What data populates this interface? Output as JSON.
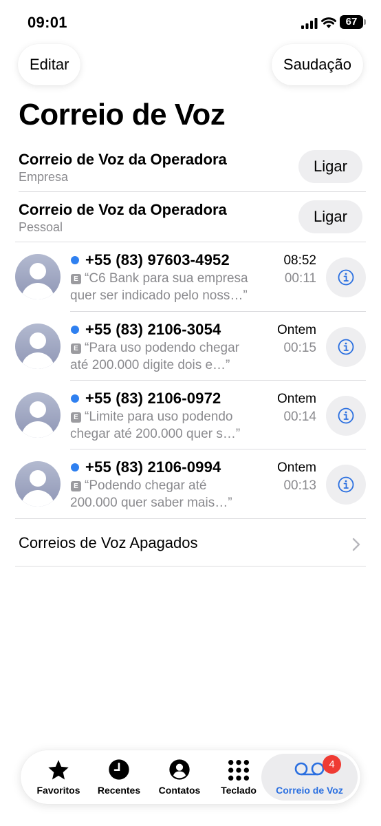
{
  "status_bar": {
    "time": "09:01",
    "battery": "67",
    "icons": [
      "cellular-signal-icon",
      "wifi-icon",
      "battery-icon"
    ]
  },
  "header": {
    "edit_label": "Editar",
    "greeting_label": "Saudação",
    "title": "Correio de Voz"
  },
  "carriers": [
    {
      "name": "Correio de Voz da Operadora",
      "subtitle": "Empresa",
      "call_label": "Ligar"
    },
    {
      "name": "Correio de Voz da Operadora",
      "subtitle": "Pessoal",
      "call_label": "Ligar"
    }
  ],
  "voicemails": [
    {
      "number": "+55 (83) 97603-4952",
      "transcript_line1": "“C6 Bank para sua empresa",
      "transcript_line2": "quer ser indicado pelo noss…”",
      "time": "08:52",
      "duration": "00:11",
      "badge": "E"
    },
    {
      "number": "+55 (83) 2106-3054",
      "transcript_line1": "“Para uso podendo chegar",
      "transcript_line2": "até 200.000 digite dois e…”",
      "time": "Ontem",
      "duration": "00:15",
      "badge": "E"
    },
    {
      "number": "+55 (83) 2106-0972",
      "transcript_line1": "“Limite para uso podendo",
      "transcript_line2": "chegar até 200.000 quer s…”",
      "time": "Ontem",
      "duration": "00:14",
      "badge": "E"
    },
    {
      "number": "+55 (83) 2106-0994",
      "transcript_line1": "“Podendo chegar até",
      "transcript_line2": "200.000 quer saber mais…”",
      "time": "Ontem",
      "duration": "00:13",
      "badge": "E"
    }
  ],
  "deleted": {
    "label": "Correios de Voz Apagados"
  },
  "tabs": [
    {
      "label": "Favoritos",
      "icon": "star-icon"
    },
    {
      "label": "Recentes",
      "icon": "clock-icon"
    },
    {
      "label": "Contatos",
      "icon": "person-circle-icon"
    },
    {
      "label": "Teclado",
      "icon": "keypad-icon"
    },
    {
      "label": "Correio de Voz",
      "icon": "voicemail-icon",
      "active": true,
      "badge": "4"
    }
  ],
  "colors": {
    "accent": "#2a6fe0",
    "unread_dot": "#2f80f0",
    "badge": "#ef3b33",
    "secondary_text": "#8a8a8e"
  }
}
